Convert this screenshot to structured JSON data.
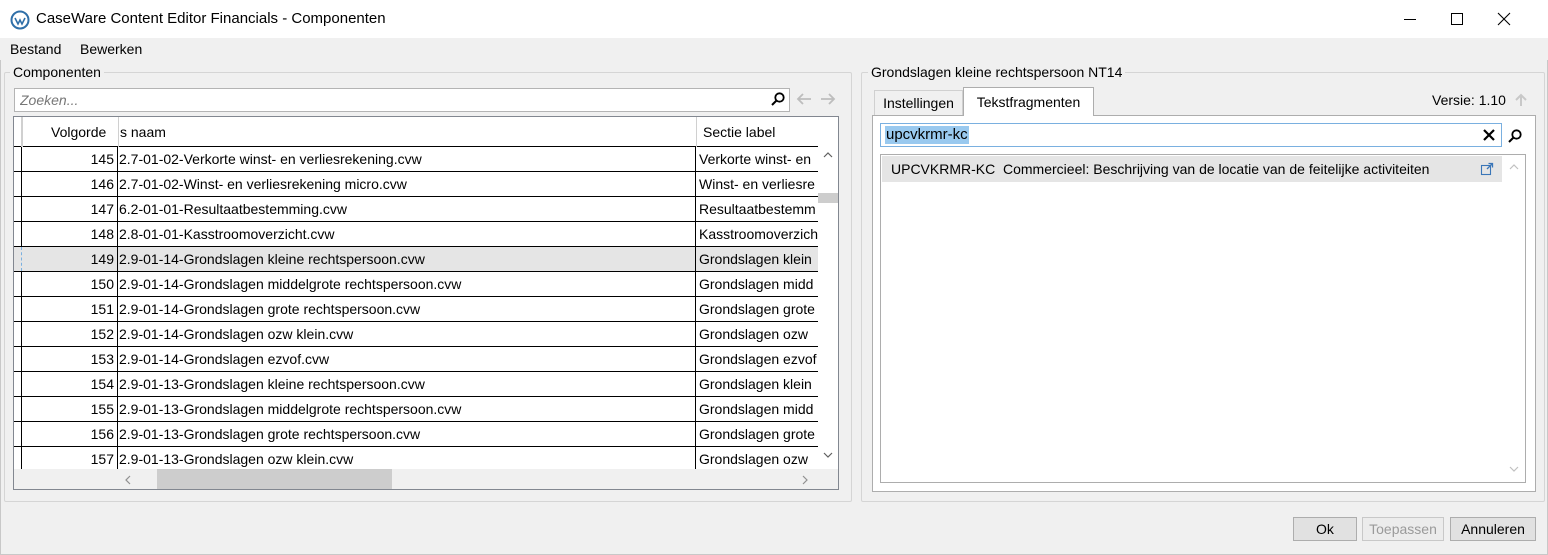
{
  "window": {
    "title": "CaseWare Content Editor Financials - Componenten"
  },
  "menu": {
    "bestand": "Bestand",
    "bewerken": "Bewerken"
  },
  "left": {
    "group_title": "Componenten",
    "search_placeholder": "Zoeken...",
    "columns": {
      "volgorde": "Volgorde",
      "naam": "s naam",
      "label": "Sectie label"
    },
    "rows": [
      {
        "volgorde": "145",
        "naam": "2.7-01-02-Verkorte winst- en verliesrekening.cvw",
        "label": "Verkorte winst- en"
      },
      {
        "volgorde": "146",
        "naam": "2.7-01-02-Winst- en verliesrekening micro.cvw",
        "label": "Winst- en verliesre"
      },
      {
        "volgorde": "147",
        "naam": "6.2-01-01-Resultaatbestemming.cvw",
        "label": "Resultaatbestemm"
      },
      {
        "volgorde": "148",
        "naam": "2.8-01-01-Kasstroomoverzicht.cvw",
        "label": "Kasstroomoverzich"
      },
      {
        "volgorde": "149",
        "naam": "2.9-01-14-Grondslagen kleine rechtspersoon.cvw",
        "label": "Grondslagen klein"
      },
      {
        "volgorde": "150",
        "naam": "2.9-01-14-Grondslagen middelgrote rechtspersoon.cvw",
        "label": "Grondslagen midd"
      },
      {
        "volgorde": "151",
        "naam": "2.9-01-14-Grondslagen grote rechtspersoon.cvw",
        "label": "Grondslagen grote"
      },
      {
        "volgorde": "152",
        "naam": "2.9-01-14-Grondslagen ozw klein.cvw",
        "label": "Grondslagen ozw"
      },
      {
        "volgorde": "153",
        "naam": "2.9-01-14-Grondslagen ezvof.cvw",
        "label": "Grondslagen ezvof"
      },
      {
        "volgorde": "154",
        "naam": "2.9-01-13-Grondslagen kleine rechtspersoon.cvw",
        "label": "Grondslagen klein"
      },
      {
        "volgorde": "155",
        "naam": "2.9-01-13-Grondslagen middelgrote rechtspersoon.cvw",
        "label": "Grondslagen midd"
      },
      {
        "volgorde": "156",
        "naam": "2.9-01-13-Grondslagen grote rechtspersoon.cvw",
        "label": "Grondslagen grote"
      },
      {
        "volgorde": "157",
        "naam": "2.9-01-13-Grondslagen ozw klein.cvw",
        "label": "Grondslagen ozw"
      }
    ],
    "selected_index": 4
  },
  "right": {
    "group_title": "Grondslagen kleine rechtspersoon NT14",
    "tabs": [
      "Instellingen",
      "Tekstfragmenten"
    ],
    "active_tab": "Tekstfragmenten",
    "versie": "Versie: 1.10",
    "fragment_search_value": "upcvkrmr-kc",
    "fragments": [
      {
        "code": "UPCVKRMR-KC",
        "description": "Commercieel: Beschrijving van de locatie van de feitelijke activiteiten"
      }
    ]
  },
  "buttons": {
    "ok": "Ok",
    "toepassen": "Toepassen",
    "annuleren": "Annuleren"
  },
  "colors": {
    "selection_highlight": "#99c9ef",
    "selected_row": "#e5e5e5",
    "window_bg": "#f0f0f0"
  }
}
